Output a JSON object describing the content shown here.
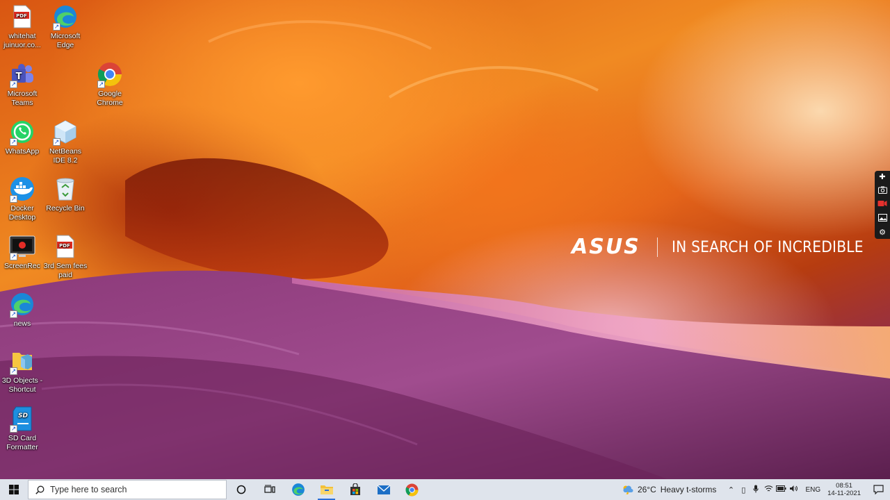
{
  "desktop_icons": [
    {
      "label": "whitehat juinuor.co...",
      "icon": "pdf-file-icon"
    },
    {
      "label": "Microsoft Edge",
      "icon": "edge-icon"
    },
    {
      "label": "Microsoft Teams",
      "icon": "teams-icon"
    },
    {
      "label": "Google Chrome",
      "icon": "chrome-icon"
    },
    {
      "label": "WhatsApp",
      "icon": "whatsapp-icon"
    },
    {
      "label": "NetBeans IDE 8.2",
      "icon": "netbeans-icon"
    },
    {
      "label": "Docker Desktop",
      "icon": "docker-icon"
    },
    {
      "label": "Recycle Bin",
      "icon": "recycle-bin-icon"
    },
    {
      "label": "ScreenRec",
      "icon": "screenrec-icon"
    },
    {
      "label": "3rd Sem fees paid",
      "icon": "pdf-file-icon"
    },
    {
      "label": "news",
      "icon": "edge-icon"
    },
    {
      "label": "3D Objects - Shortcut",
      "icon": "folder-icon"
    },
    {
      "label": "SD Card Formatter",
      "icon": "sd-card-icon"
    }
  ],
  "wallpaper": {
    "brand": "ASUS",
    "tagline": "IN SEARCH OF INCREDIBLE"
  },
  "taskbar": {
    "search_placeholder": "Type here to search",
    "pinned": [
      "cortana-icon",
      "task-view-icon",
      "edge-icon",
      "file-explorer-icon",
      "store-icon",
      "mail-icon",
      "chrome-icon"
    ],
    "weather": {
      "temp": "26°C",
      "condition": "Heavy t-storms"
    },
    "language": "ENG",
    "time": "08:51",
    "date": "14-11-2021"
  },
  "colors": {
    "taskbar_bg": "#dfe4ec",
    "accent": "#2a6fd6"
  }
}
